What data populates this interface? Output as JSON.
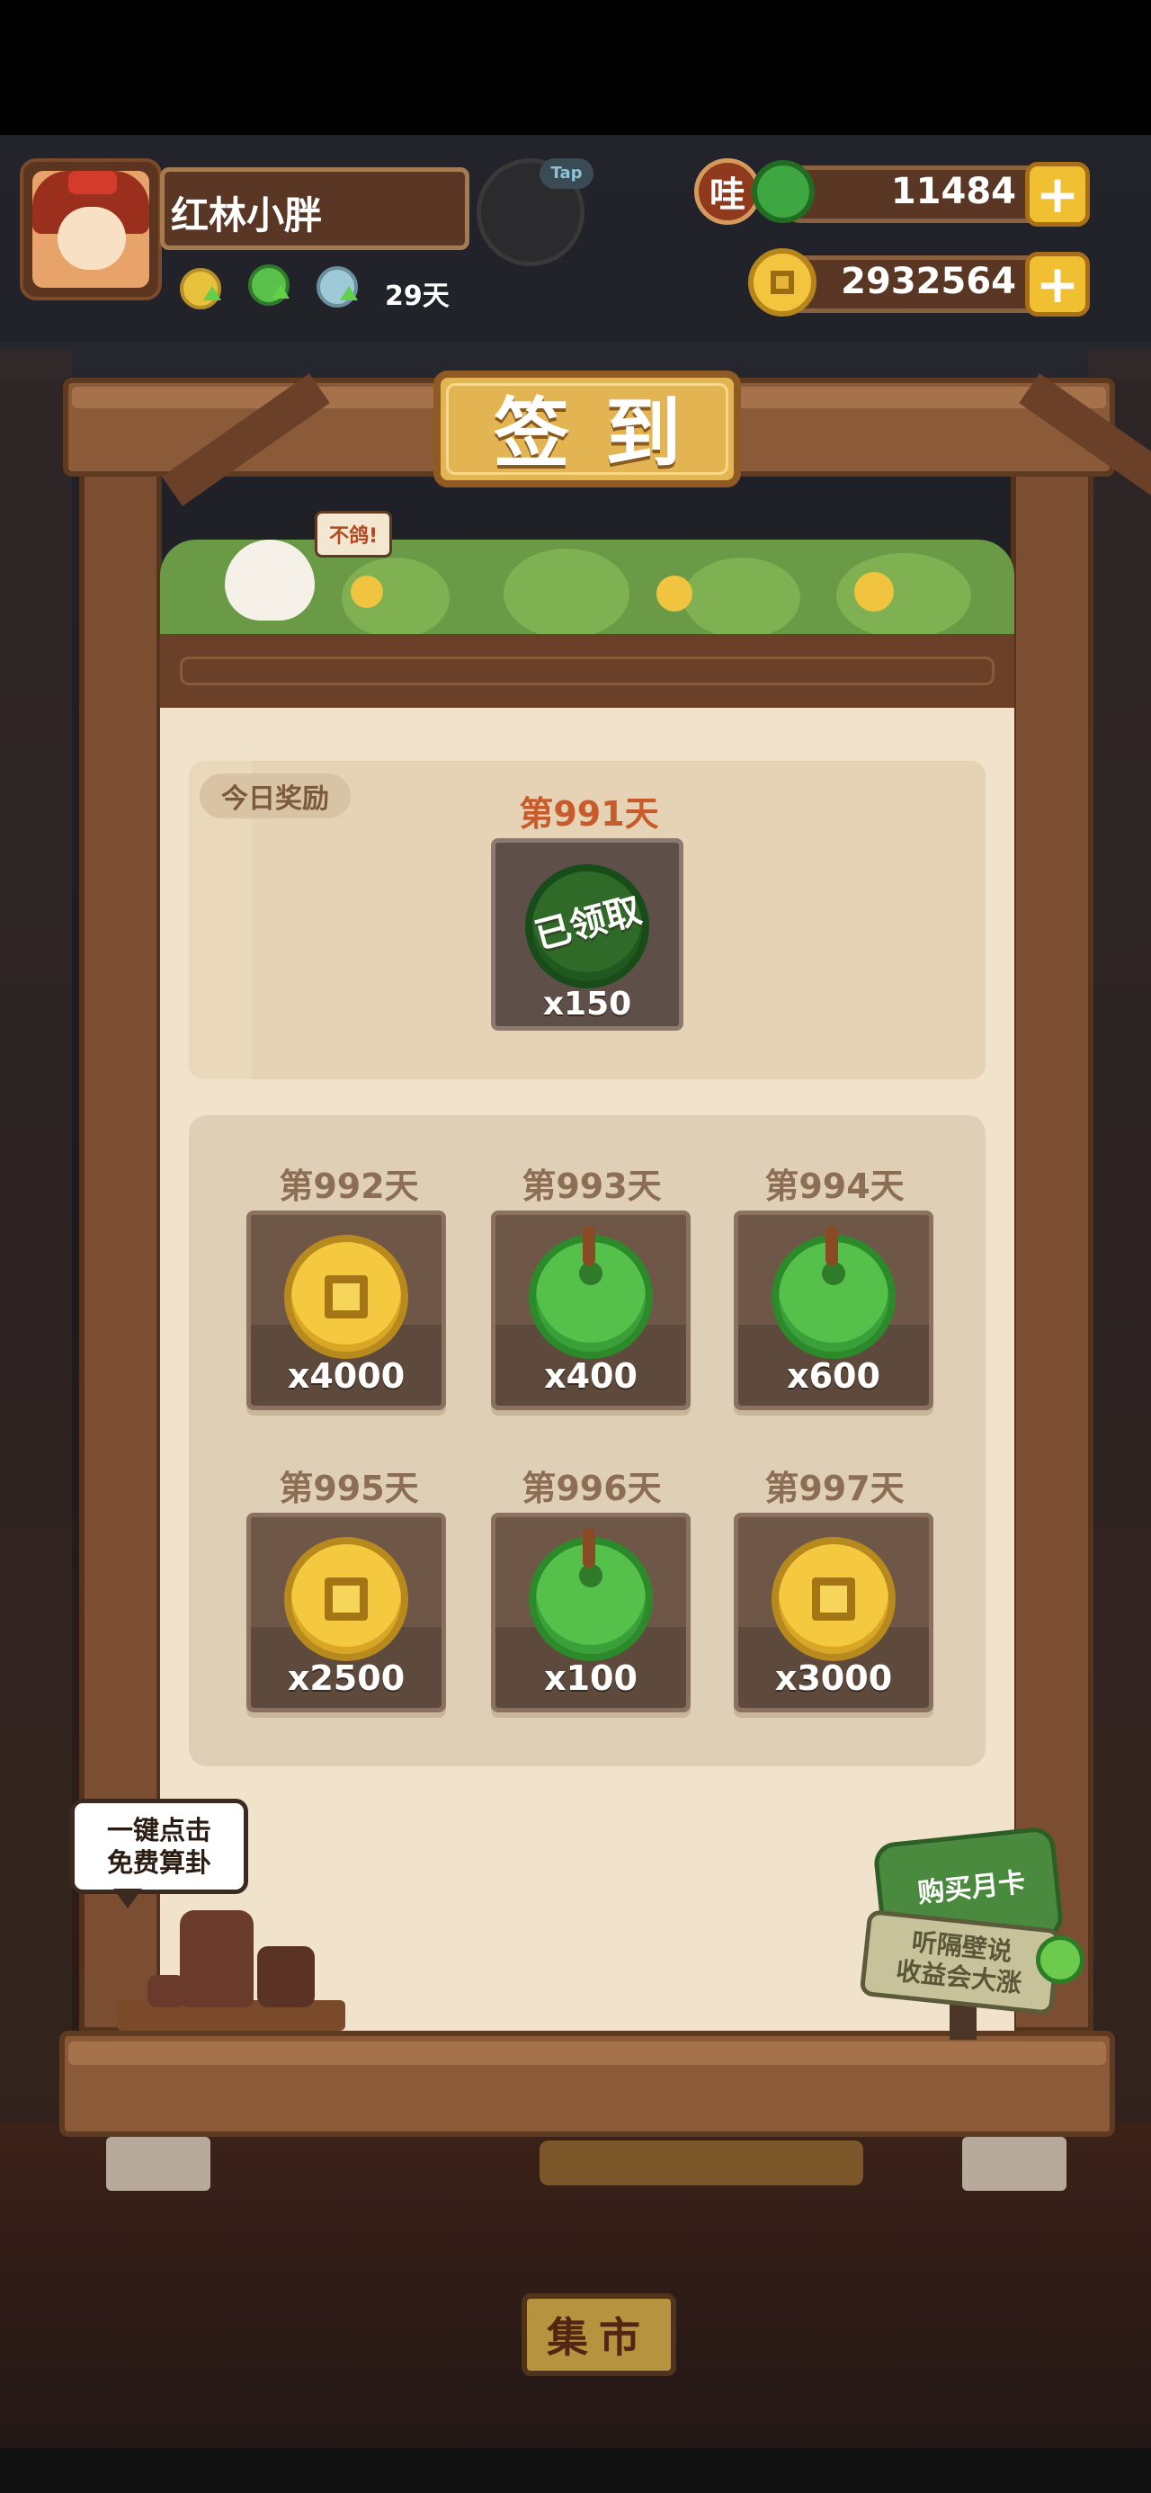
{
  "player": {
    "name": "红林小胖",
    "days": "29天",
    "tap_label": "Tap"
  },
  "currency": {
    "jade_value": "11484",
    "coin_value": "2932564",
    "wa_label": "哇",
    "plus_symbol": "+"
  },
  "panel": {
    "title": "签到",
    "bird_sign": "不鸽!"
  },
  "today": {
    "chip_label": "今日奖励",
    "day_label": "第991天",
    "status": "已领取",
    "amount": "x150"
  },
  "rewards": [
    {
      "day": "第992天",
      "type": "coin",
      "amount": "x4000"
    },
    {
      "day": "第993天",
      "type": "jade",
      "amount": "x400"
    },
    {
      "day": "第994天",
      "type": "jade",
      "amount": "x600"
    },
    {
      "day": "第995天",
      "type": "coin",
      "amount": "x2500"
    },
    {
      "day": "第996天",
      "type": "jade",
      "amount": "x100"
    },
    {
      "day": "第997天",
      "type": "coin",
      "amount": "x3000"
    }
  ],
  "fortune": {
    "line1": "一键点击",
    "line2": "免费算卦"
  },
  "monthly": {
    "button": "购买月卡",
    "line1": "听隔壁说",
    "line2": "收益会大涨"
  },
  "scene": {
    "market_sign": "集市"
  },
  "colors": {
    "wood": "#8a5a39",
    "cream": "#f0e2cb",
    "gold": "#e3b552",
    "jade": "#55c04a",
    "coin": "#f4c93f"
  }
}
